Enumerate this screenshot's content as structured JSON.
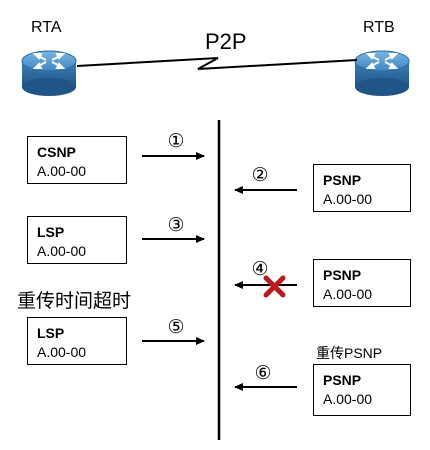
{
  "routers": {
    "left": "RTA",
    "right": "RTB"
  },
  "link_label": "P2P",
  "packets": [
    {
      "type": "CSNP",
      "id": "A.00-00"
    },
    {
      "type": "PSNP",
      "id": "A.00-00"
    },
    {
      "type": "LSP",
      "id": "A.00-00"
    },
    {
      "type": "PSNP",
      "id": "A.00-00"
    },
    {
      "type": "LSP",
      "id": "A.00-00"
    },
    {
      "type": "PSNP",
      "id": "A.00-00"
    }
  ],
  "steps": [
    "①",
    "②",
    "③",
    "④",
    "⑤",
    "⑥"
  ],
  "notes": {
    "retransmit_timeout": "重传时间超时",
    "retransmit_psnp": "重传PSNP"
  },
  "colors": {
    "router_body": "#2f6fa5",
    "router_top": "#4a90c8",
    "lost_mark": "#c0161e"
  },
  "icons": [
    "router-icon",
    "lost-packet-x-icon"
  ]
}
